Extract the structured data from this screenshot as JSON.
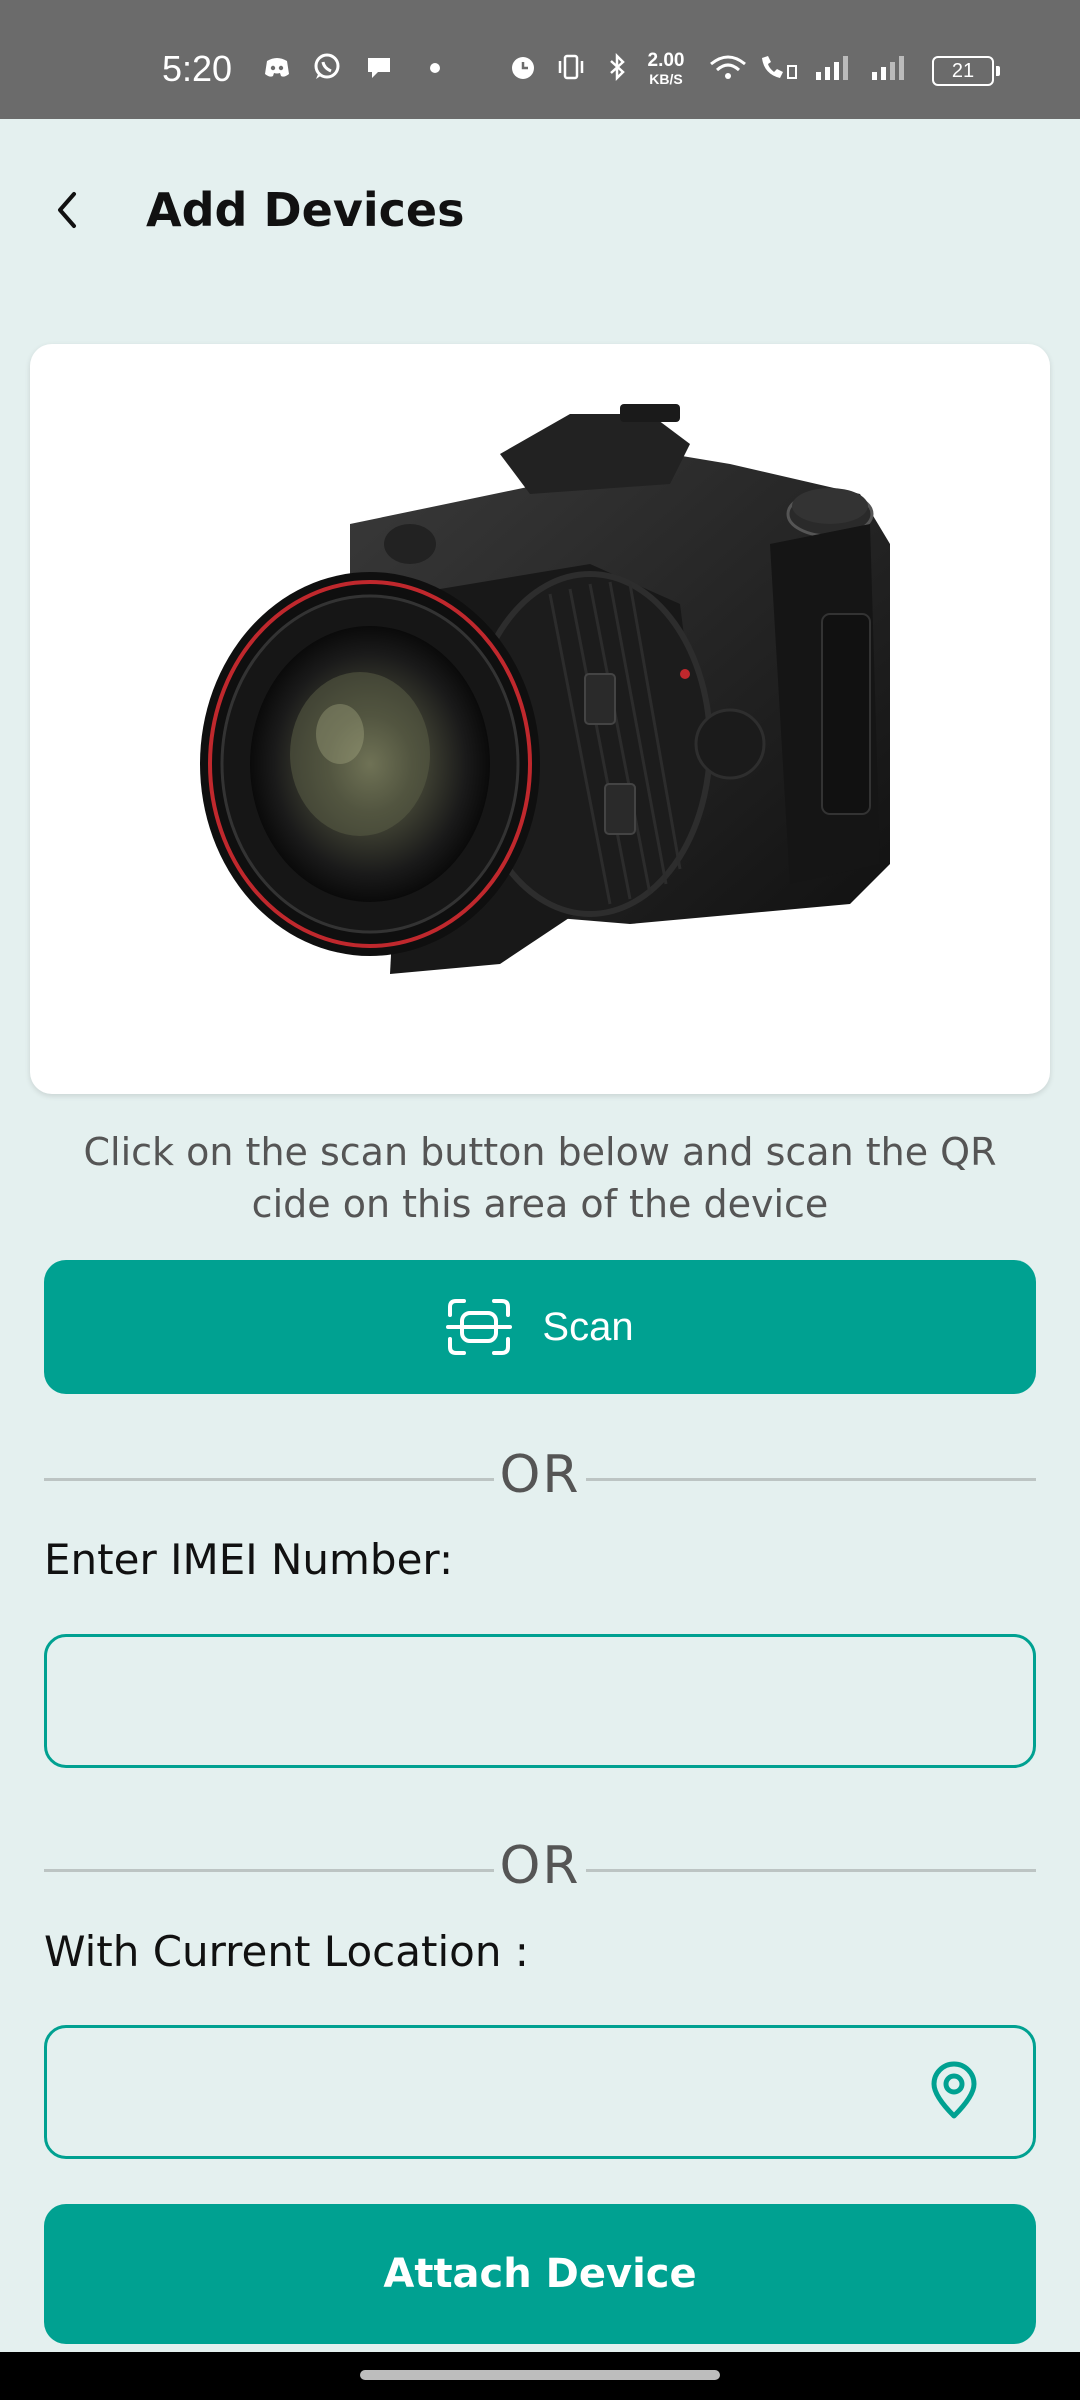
{
  "status_bar": {
    "time": "5:20",
    "net_speed_value": "2.00",
    "net_speed_unit": "KB/S",
    "battery": "21",
    "icons": [
      "discord-icon",
      "whatsapp-icon",
      "chat-bubble-icon",
      "dot-icon",
      "alarm-icon",
      "vibrate-icon",
      "bluetooth-icon",
      "wifi-icon",
      "wifi-calling-icon",
      "signal-icon",
      "signal-icon-2",
      "battery-icon"
    ]
  },
  "header": {
    "back_icon": "chevron-left-icon",
    "title": "Add Devices"
  },
  "device_image": {
    "subject": "camera"
  },
  "instruction": "Click on the scan button below and scan the QR cide on this area of the device",
  "scan_button": {
    "label": "Scan",
    "icon": "scan-frame-icon"
  },
  "divider_1": "OR",
  "imei": {
    "label": "Enter IMEI Number:",
    "value": "",
    "placeholder": ""
  },
  "divider_2": "OR",
  "location": {
    "label": "With Current Location :",
    "value": "",
    "placeholder": "",
    "icon": "location-pin-icon"
  },
  "attach_button": {
    "label": "Attach Device"
  },
  "colors": {
    "accent": "#00a191",
    "background": "#e4f0ef",
    "status_bar": "#6b6b6b"
  }
}
